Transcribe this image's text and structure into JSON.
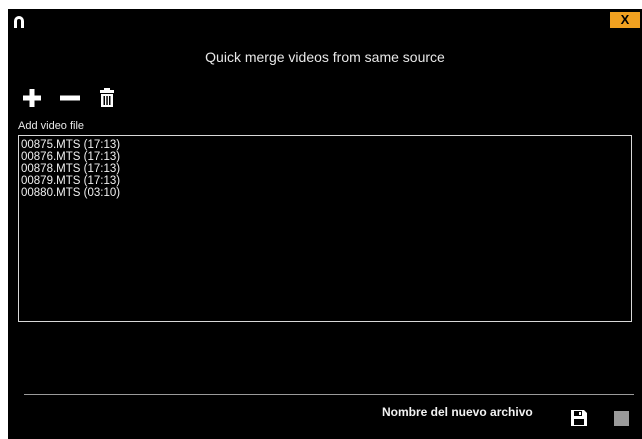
{
  "window": {
    "title": "Quick merge videos from same source",
    "close_label": "X"
  },
  "toolbar": {
    "add_icon": "plus-icon",
    "remove_icon": "minus-icon",
    "clear_icon": "trash-icon"
  },
  "file_list": {
    "label": "Add video file",
    "items": [
      "00875.MTS (17:13)",
      "00876.MTS (17:13)",
      "00878.MTS (17:13)",
      "00879.MTS (17:13)",
      "00880.MTS (03:10)"
    ]
  },
  "footer": {
    "output_label": "Nombre del nuevo archivo",
    "save_icon": "floppy-disk-icon",
    "stop_icon": "stop-icon"
  },
  "colors": {
    "background": "#000000",
    "accent": "#f0a020",
    "border": "#d8d8d8"
  }
}
